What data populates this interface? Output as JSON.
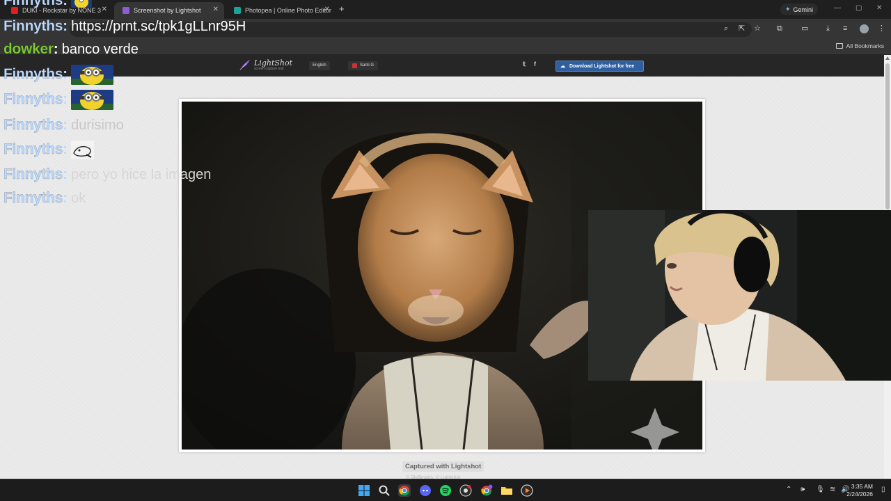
{
  "browser": {
    "tabs": [
      {
        "title": "DUKI - Rockstar by NONE 3",
        "favicon_color": "#e02020",
        "active": false
      },
      {
        "title": "Screenshot by Lightshot",
        "favicon_color": "#8b5fd1",
        "active": true
      },
      {
        "title": "Photopea | Online Photo Editor",
        "favicon_color": "#18a497",
        "active": false
      }
    ],
    "new_tab_symbol": "+",
    "gemini_label": "Gemini",
    "all_bookmarks": "All Bookmarks",
    "address_placeholder": "prnt.sc/tpk1gLLnr95H"
  },
  "lightshot": {
    "logo_name": "LightShot",
    "logo_tagline": "screen capture tool",
    "language": "English",
    "user": "Santi G",
    "download_button": "Download Lightshot for free",
    "caption": "Captured with Lightshot",
    "footer_faded": "© Skillbrains, © Lightshot"
  },
  "chat": [
    {
      "user": "Finnyths",
      "color": "#bcd9ff",
      "text": "",
      "emote": "minion-emote"
    },
    {
      "user": "Finnyths",
      "color": "#bcd9ff",
      "text": "https://prnt.sc/tpk1gLLnr95H"
    },
    {
      "user": "dowker",
      "color": "#7dcc34",
      "text": "banco verde"
    },
    {
      "user": "Finnyths",
      "color": "#bcd9ff",
      "text": "",
      "emote": "minion-emote"
    },
    {
      "user": "Finnyths",
      "color": "#bcd9ff",
      "text": "",
      "emote": "minion-emote"
    },
    {
      "user": "Finnyths",
      "color": "#bcd9ff",
      "text": "durisimo"
    },
    {
      "user": "Finnyths",
      "color": "#bcd9ff",
      "text": "",
      "emote": "sketch-emote"
    },
    {
      "user": "Finnyths",
      "color": "#bcd9ff",
      "text": "pero yo hice la imagen"
    },
    {
      "user": "Finnyths",
      "color": "#bcd9ff",
      "text": "ok"
    }
  ],
  "taskbar": {
    "time": "3:35 AM",
    "date": "2/24/2026",
    "apps": [
      "windows-start-icon",
      "search-icon",
      "chrome-icon",
      "discord-icon",
      "spotify-icon",
      "github-icon",
      "chrome-alt-icon",
      "file-explorer-icon",
      "media-player-icon"
    ]
  },
  "colors": {
    "accent": "#2f5f9e",
    "chat_name": "#bcd9ff",
    "chat_name_alt": "#7dcc34"
  }
}
